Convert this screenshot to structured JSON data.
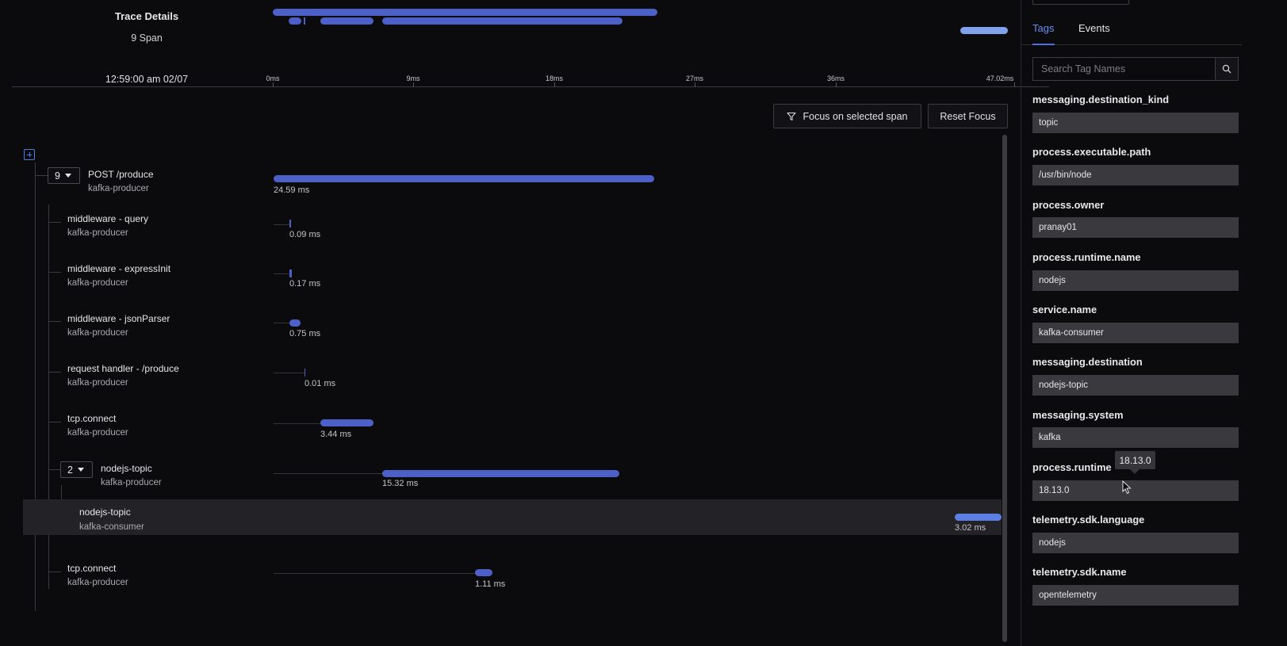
{
  "header": {
    "title": "Trace Details",
    "span_count": "9 Span",
    "timestamp": "12:59:00 am 02/07"
  },
  "axis": {
    "ticks": [
      "0ms",
      "9ms",
      "18ms",
      "27ms",
      "36ms",
      "47.02ms"
    ]
  },
  "toolbar": {
    "focus_label": "Focus on selected span",
    "reset_label": "Reset Focus"
  },
  "spans": [
    {
      "name": "POST /produce",
      "service": "kafka-producer",
      "duration": "24.59 ms",
      "children": "9"
    },
    {
      "name": "middleware - query",
      "service": "kafka-producer",
      "duration": "0.09 ms"
    },
    {
      "name": "middleware - expressInit",
      "service": "kafka-producer",
      "duration": "0.17 ms"
    },
    {
      "name": "middleware - jsonParser",
      "service": "kafka-producer",
      "duration": "0.75 ms"
    },
    {
      "name": "request handler - /produce",
      "service": "kafka-producer",
      "duration": "0.01 ms"
    },
    {
      "name": "tcp.connect",
      "service": "kafka-producer",
      "duration": "3.44 ms"
    },
    {
      "name": "nodejs-topic",
      "service": "kafka-producer",
      "duration": "15.32 ms",
      "children": "2"
    },
    {
      "name": "nodejs-topic",
      "service": "kafka-consumer",
      "duration": "3.02 ms",
      "selected": true
    },
    {
      "name": "tcp.connect",
      "service": "kafka-producer",
      "duration": "1.11 ms"
    }
  ],
  "panel": {
    "tabs": [
      "Tags",
      "Events"
    ],
    "active_tab": "Tags",
    "search_placeholder": "Search Tag Names",
    "tags": [
      {
        "key": "messaging.destination_kind",
        "value": "topic"
      },
      {
        "key": "process.executable.path",
        "value": "/usr/bin/node"
      },
      {
        "key": "process.owner",
        "value": "pranay01"
      },
      {
        "key": "process.runtime.name",
        "value": "nodejs"
      },
      {
        "key": "service.name",
        "value": "kafka-consumer"
      },
      {
        "key": "messaging.destination",
        "value": "nodejs-topic"
      },
      {
        "key": "messaging.system",
        "value": "kafka"
      },
      {
        "key": "process.runtime",
        "value": "18.13.0"
      },
      {
        "key": "telemetry.sdk.language",
        "value": "nodejs"
      },
      {
        "key": "telemetry.sdk.name",
        "value": "opentelemetry"
      }
    ],
    "tooltip": "18.13.0"
  },
  "colors": {
    "accent": "#6b8ff2",
    "span_bar": "#4d60c8",
    "selected_bar": "#5c7fe6",
    "mini_light": "#7fa1ec"
  }
}
